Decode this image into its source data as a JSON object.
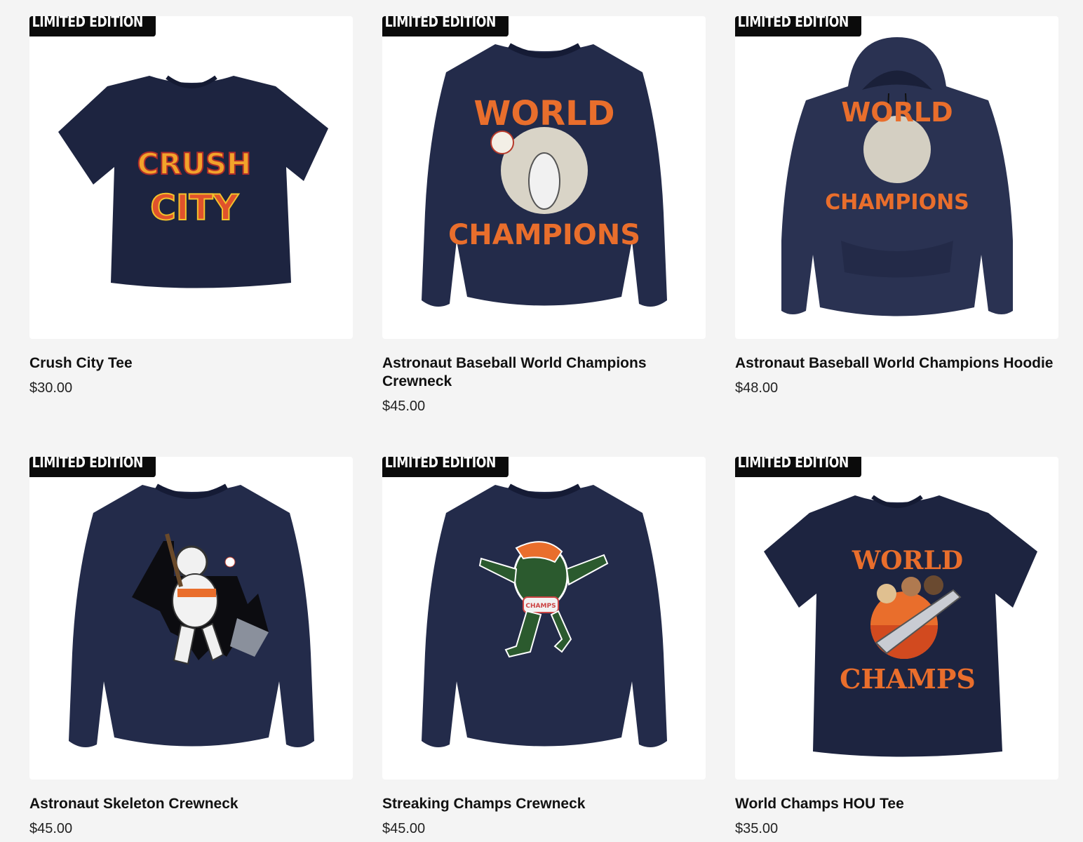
{
  "badge_label": "LIMITED EDITION",
  "colors": {
    "navy": "#232b4a",
    "navy_dark": "#1c2340",
    "orange": "#e96e2c",
    "page_bg": "#f4f4f4"
  },
  "products": [
    {
      "title": "Crush City Tee",
      "price": "$30.00",
      "garment": "tee",
      "graphic_text": [
        "CRUSH",
        "CITY"
      ]
    },
    {
      "title": "Astronaut Baseball World Champions Crewneck",
      "price": "$45.00",
      "garment": "crewneck",
      "graphic_text": [
        "WORLD",
        "CHAMPIONS"
      ]
    },
    {
      "title": "Astronaut Baseball World Champions Hoodie",
      "price": "$48.00",
      "garment": "hoodie",
      "graphic_text": [
        "WORLD",
        "CHAMPIONS"
      ]
    },
    {
      "title": "Astronaut Skeleton Crewneck",
      "price": "$45.00",
      "garment": "crewneck",
      "graphic_text": []
    },
    {
      "title": "Streaking Champs Crewneck",
      "price": "$45.00",
      "garment": "crewneck",
      "graphic_text": [
        "CHAMPS"
      ]
    },
    {
      "title": "World Champs HOU Tee",
      "price": "$35.00",
      "garment": "tee",
      "graphic_text": [
        "WORLD",
        "CHAMPS"
      ]
    }
  ]
}
